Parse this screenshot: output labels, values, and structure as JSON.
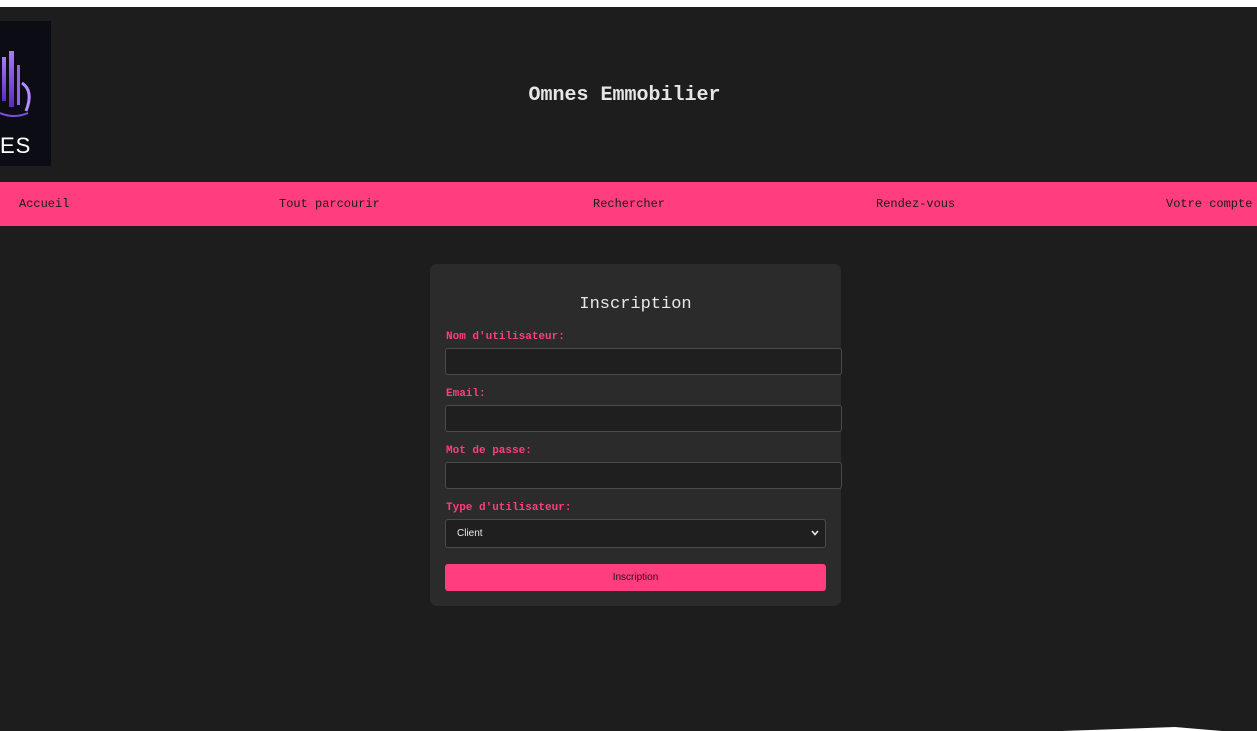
{
  "header": {
    "logo_text": "ES",
    "title": "Omnes Emmobilier"
  },
  "nav": {
    "items": [
      {
        "label": "Accueil"
      },
      {
        "label": "Tout parcourir"
      },
      {
        "label": "Rechercher"
      },
      {
        "label": "Rendez-vous"
      },
      {
        "label": "Votre compte"
      }
    ]
  },
  "form": {
    "title": "Inscription",
    "username_label": "Nom d'utilisateur:",
    "username_value": "",
    "email_label": "Email:",
    "email_value": "",
    "password_label": "Mot de passe:",
    "password_value": "",
    "type_label": "Type d'utilisateur:",
    "type_selected": "Client",
    "submit_label": "Inscription"
  },
  "colors": {
    "background": "#1d1d1d",
    "accent": "#ff3d7f",
    "card": "#2b2b2b"
  },
  "icons": {
    "logo": "building-logo-icon",
    "select_arrow": "chevron-down-icon"
  }
}
